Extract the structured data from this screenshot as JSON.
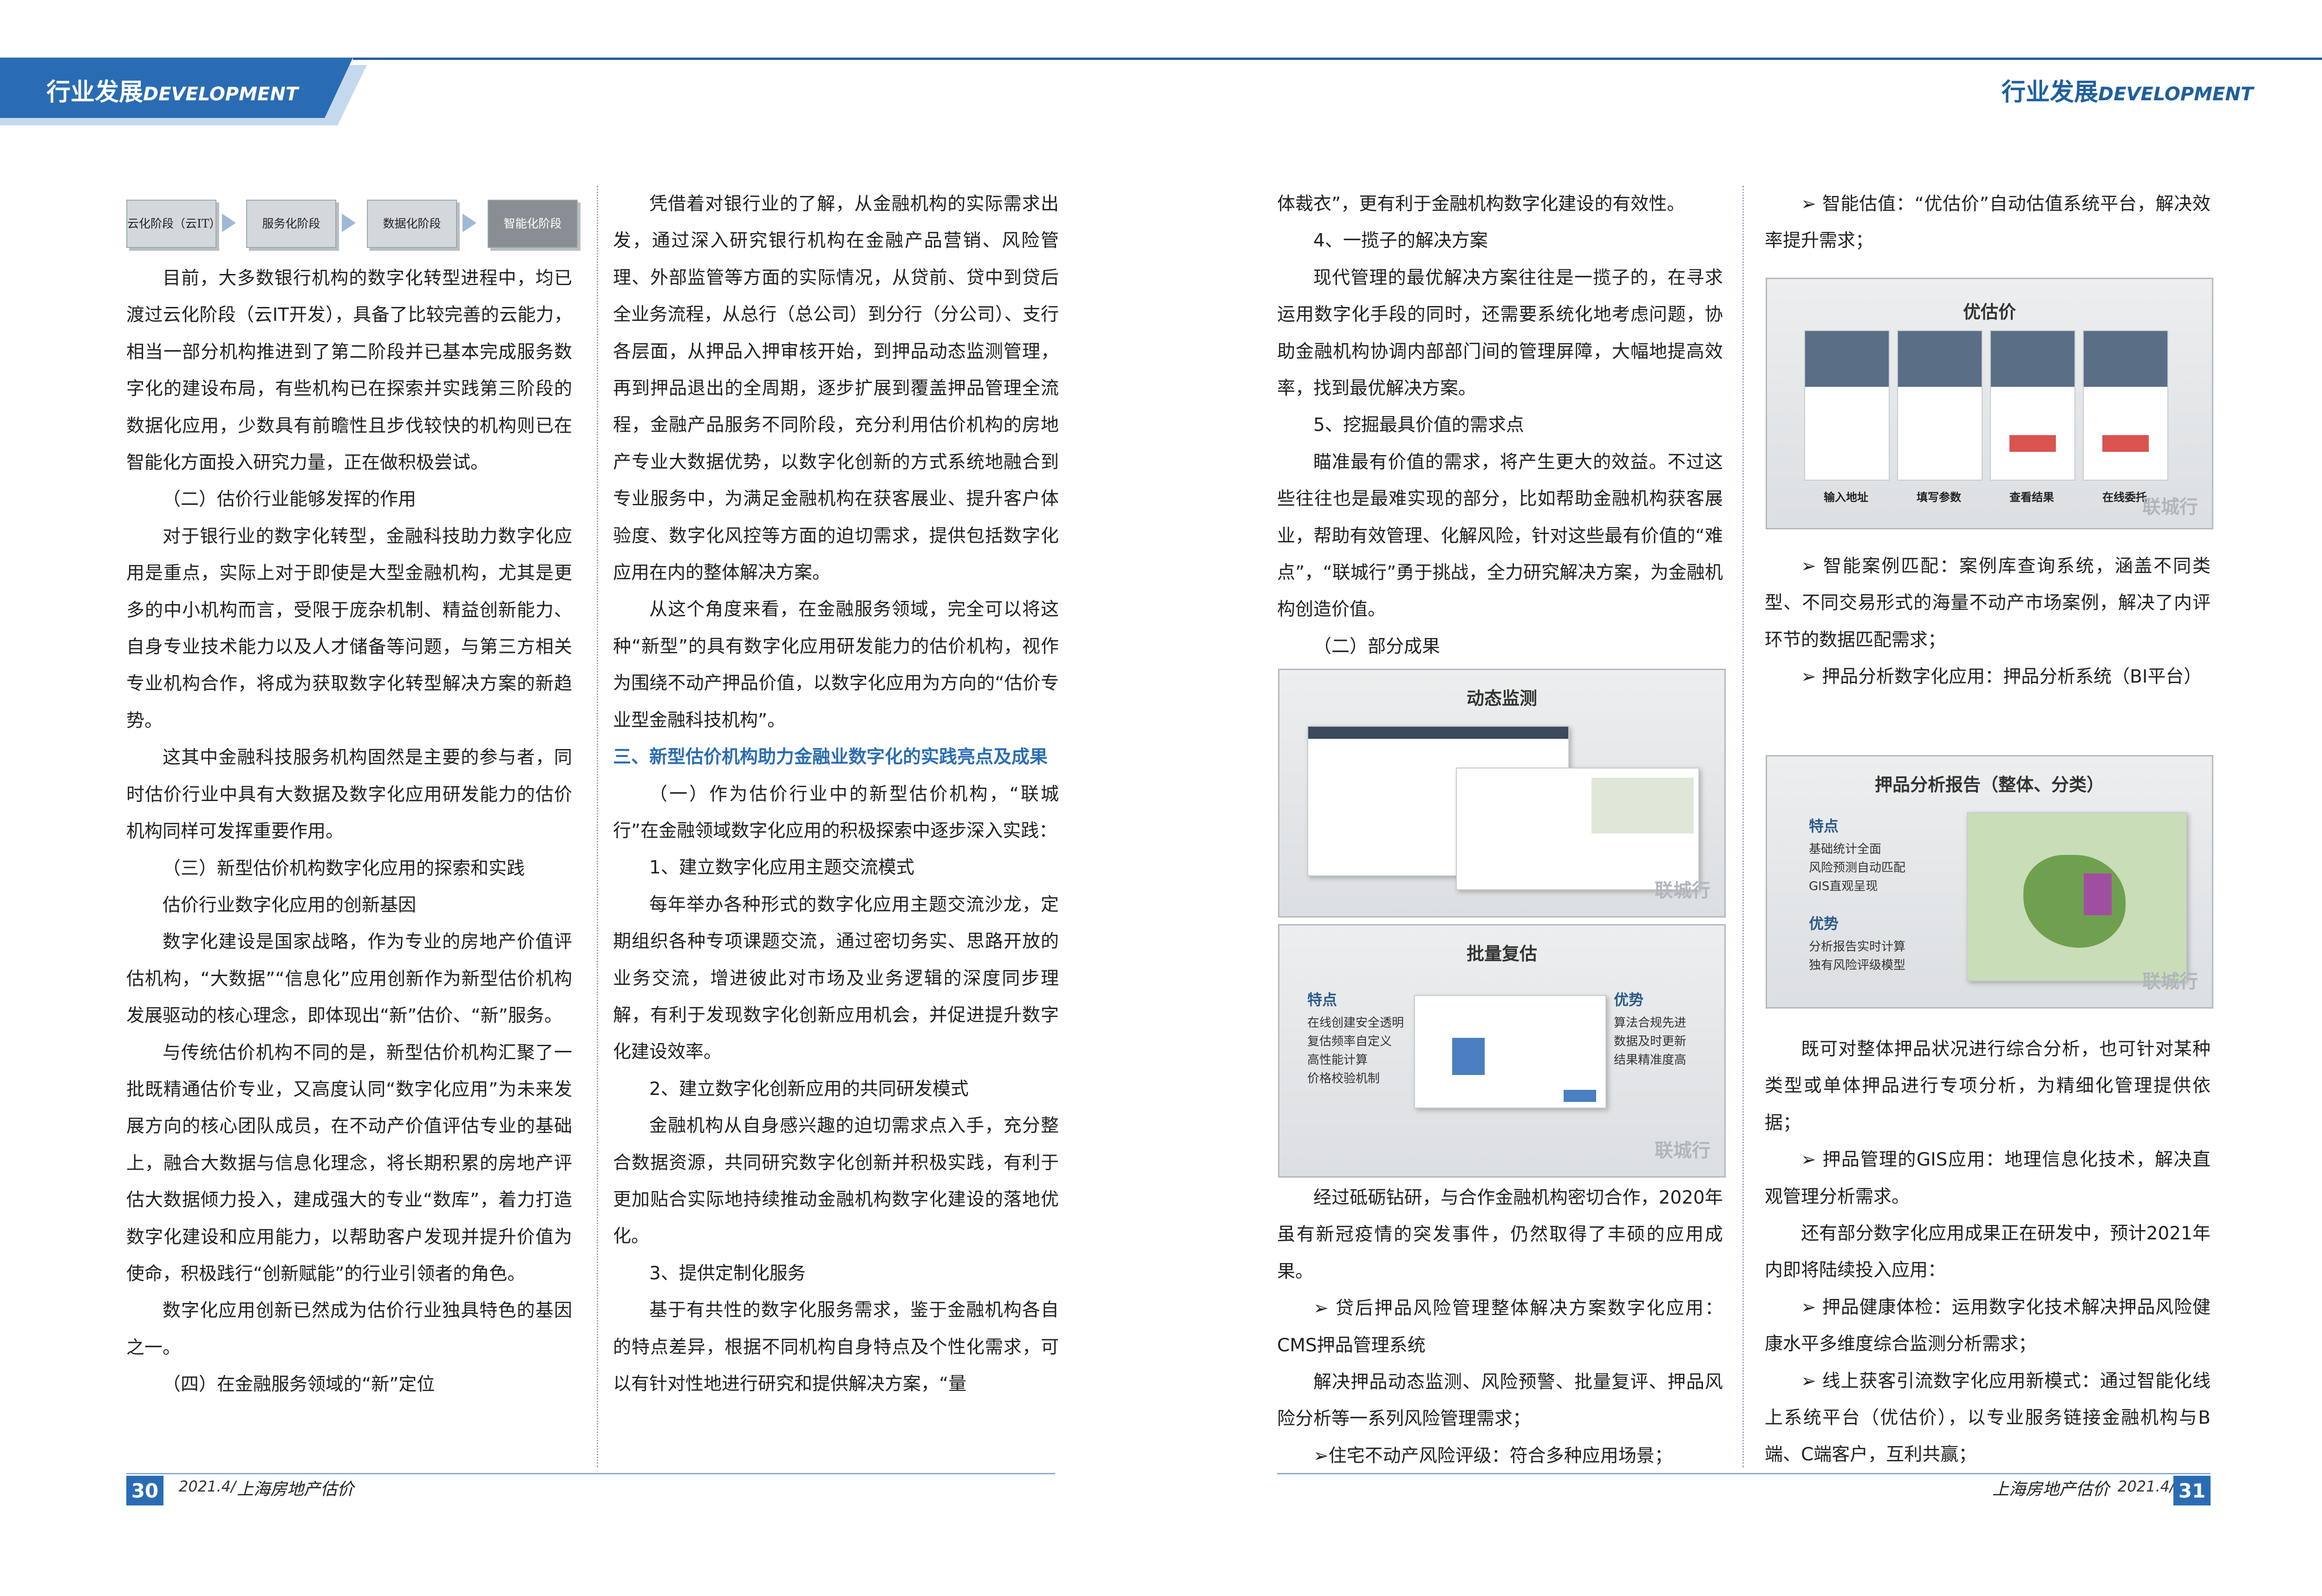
{
  "header": {
    "left_cn": "行业发展",
    "left_en": "DEVELOPMENT",
    "right_cn": "行业发展",
    "right_en": "DEVELOPMENT"
  },
  "stages": [
    "云化阶段（云IT）",
    "服务化阶段",
    "数据化阶段",
    "智能化阶段"
  ],
  "col1": {
    "p1": "目前，大多数银行机构的数字化转型进程中，均已渡过云化阶段（云IT开发），具备了比较完善的云能力，相当一部分机构推进到了第二阶段并已基本完成服务数字化的建设布局，有些机构已在探索并实践第三阶段的数据化应用，少数具有前瞻性且步伐较快的机构则已在智能化方面投入研究力量，正在做积极尝试。",
    "h2": "（二）估价行业能够发挥的作用",
    "p2": "对于银行业的数字化转型，金融科技助力数字化应用是重点，实际上对于即使是大型金融机构，尤其是更多的中小机构而言，受限于庞杂机制、精益创新能力、自身专业技术能力以及人才储备等问题，与第三方相关专业机构合作，将成为获取数字化转型解决方案的新趋势。",
    "p3": "这其中金融科技服务机构固然是主要的参与者，同时估价行业中具有大数据及数字化应用研发能力的估价机构同样可发挥重要作用。",
    "h3": "（三）新型估价机构数字化应用的探索和实践",
    "h3b": "估价行业数字化应用的创新基因",
    "p4": "数字化建设是国家战略，作为专业的房地产价值评估机构，“大数据”“信息化”应用创新作为新型估价机构发展驱动的核心理念，即体现出“新”估价、“新”服务。",
    "p5": "与传统估价机构不同的是，新型估价机构汇聚了一批既精通估价专业，又高度认同“数字化应用”为未来发展方向的核心团队成员，在不动产价值评估专业的基础上，融合大数据与信息化理念，将长期积累的房地产评估大数据倾力投入，建成强大的专业“数库”，着力打造数字化建设和应用能力，以帮助客户发现并提升价值为使命，积极践行“创新赋能”的行业引领者的角色。",
    "p6": "数字化应用创新已然成为估价行业独具特色的基因之一。",
    "h4": "（四）在金融服务领域的“新”定位"
  },
  "col2": {
    "p1": "凭借着对银行业的了解，从金融机构的实际需求出发，通过深入研究银行机构在金融产品营销、风险管理、外部监管等方面的实际情况，从贷前、贷中到贷后全业务流程，从总行（总公司）到分行（分公司）、支行各层面，从押品入押审核开始，到押品动态监测管理，再到押品退出的全周期，逐步扩展到覆盖押品管理全流程，金融产品服务不同阶段，充分利用估价机构的房地产专业大数据优势，以数字化创新的方式系统地融合到专业服务中，为满足金融机构在获客展业、提升客户体验度、数字化风控等方面的迫切需求，提供包括数字化应用在内的整体解决方案。",
    "p2": "从这个角度来看，在金融服务领域，完全可以将这种“新型”的具有数字化应用研发能力的估价机构，视作为围绕不动产押品价值，以数字化应用为方向的“估价专业型金融科技机构”。",
    "h3": "三、新型估价机构助力金融业数字化的实践亮点及成果",
    "p3": "（一）作为估价行业中的新型估价机构，“联城行”在金融领域数字化应用的积极探索中逐步深入实践：",
    "s1": "1、建立数字化应用主题交流模式",
    "p4": "每年举办各种形式的数字化应用主题交流沙龙，定期组织各种专项课题交流，通过密切务实、思路开放的业务交流，增进彼此对市场及业务逻辑的深度同步理解，有利于发现数字化创新应用机会，并促进提升数字化建设效率。",
    "s2": "2、建立数字化创新应用的共同研发模式",
    "p5": "金融机构从自身感兴趣的迫切需求点入手，充分整合数据资源，共同研究数字化创新并积极实践，有利于更加贴合实际地持续推动金融机构数字化建设的落地优化。",
    "s3": "3、提供定制化服务",
    "p6": "基于有共性的数字化服务需求，鉴于金融机构各自的特点差异，根据不同机构自身特点及个性化需求，可以有针对性地进行研究和提供解决方案，“量"
  },
  "col3": {
    "p0": "体裁衣”，更有利于金融机构数字化建设的有效性。",
    "s4": "4、一揽子的解决方案",
    "p1": "现代管理的最优解决方案往往是一揽子的，在寻求运用数字化手段的同时，还需要系统化地考虑问题，协助金融机构协调内部部门间的管理屏障，大幅地提高效率，找到最优解决方案。",
    "s5": "5、挖掘最具价值的需求点",
    "p2": "瞄准最有价值的需求，将产生更大的效益。不过这些往往也是最难实现的部分，比如帮助金融机构获客展业，帮助有效管理、化解风险，针对这些最有价值的“难点”，“联城行”勇于挑战，全力研究解决方案，为金融机构创造价值。",
    "h2": "（二）部分成果",
    "shot1_title": "动态监测",
    "shot2_title": "批量复估",
    "shot2_left_head": "特点",
    "shot2_left": [
      "在线创建安全透明",
      "复估频率自定义",
      "高性能计算",
      "价格校验机制"
    ],
    "shot2_right_head": "优势",
    "shot2_right": [
      "算法合规先进",
      "数据及时更新",
      "结果精准度高"
    ],
    "watermark": "联城行",
    "p3": "经过砥砺钻研，与合作金融机构密切合作，2020年虽有新冠疫情的突发事件，仍然取得了丰硕的应用成果。",
    "b1": "➢ 贷后押品风险管理整体解决方案数字化应用：CMS押品管理系统",
    "p4": "解决押品动态监测、风险预警、批量复评、押品风险分析等一系列风险管理需求；",
    "b2": "➢住宅不动产风险评级：符合多种应用场景；"
  },
  "col4": {
    "b1": "➢ 智能估值：“优估价”自动估值系统平台，解决效率提升需求；",
    "shot3_title": "优估价",
    "shot3_caps": [
      "输入地址",
      "填写参数",
      "查看结果",
      "在线委托"
    ],
    "b2": "➢ 智能案例匹配：案例库查询系统，涵盖不同类型、不同交易形式的海量不动产市场案例，解决了内评环节的数据匹配需求；",
    "b3": "➢ 押品分析数字化应用：押品分析系统（BI平台）",
    "shot4_title": "押品分析报告（整体、分类）",
    "shot4_h1": "特点",
    "shot4_l1": [
      "基础统计全面",
      "风险预测自动匹配",
      "GIS直观呈现"
    ],
    "shot4_h2": "优势",
    "shot4_l2": [
      "分析报告实时计算",
      "独有风险评级模型"
    ],
    "p1": "既可对整体押品状况进行综合分析，也可针对某种类型或单体押品进行专项分析，为精细化管理提供依据；",
    "b4": "➢ 押品管理的GIS应用：地理信息化技术，解决直观管理分析需求。",
    "p2": "还有部分数字化应用成果正在研发中，预计2021年内即将陆续投入应用：",
    "b5": "➢ 押品健康体检：运用数字化技术解决押品风险健康水平多维度综合监测分析需求；",
    "b6": "➢ 线上获客引流数字化应用新模式：通过智能化线上系统平台（优估价），以专业服务链接金融机构与B端、C端客户，互利共赢；"
  },
  "footer": {
    "left_page": "30",
    "left_date": "2021.4/",
    "left_pub": "上海房地产估价",
    "right_page": "31",
    "right_date": "2021.4/",
    "right_pub": "上海房地产估价"
  }
}
